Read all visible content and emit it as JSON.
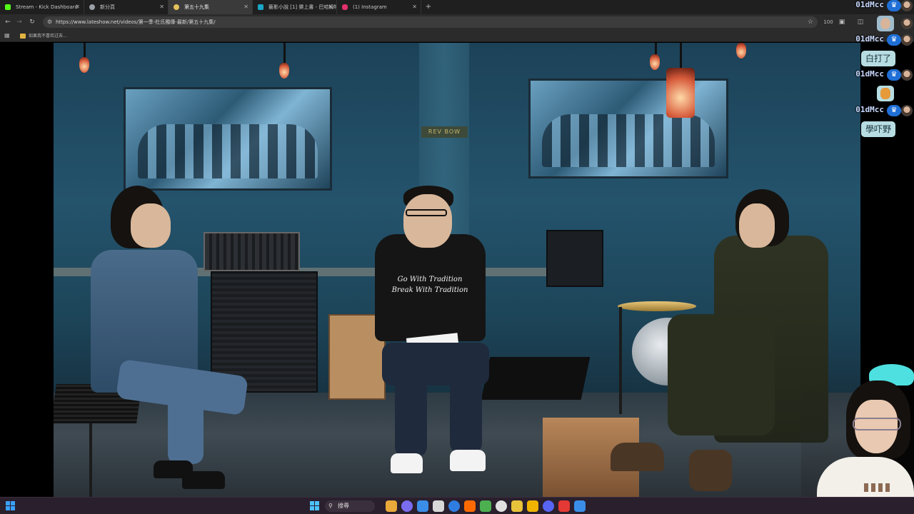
{
  "browser": {
    "tabs": [
      {
        "label": "Stream - Kick Dashboard",
        "favicon_color": "#53fc18",
        "active": false
      },
      {
        "label": "新分頁",
        "favicon_color": "#9aa0a6",
        "active": false
      },
      {
        "label": "第五十九集",
        "favicon_color": "#e2c15a",
        "active": true
      },
      {
        "label": "藝影小說 [1] 樂上書 - 巴哈姆特",
        "favicon_color": "#1aa7c7",
        "active": false
      },
      {
        "label": "(1) Instagram",
        "favicon_color": "#e1306c",
        "active": false
      }
    ],
    "new_tab_label": "+",
    "address": "https://www.lateshow.net/videos/第一季-杜氏獨傳-最新/第五十九集/",
    "zoom_badge": "100",
    "bookmarks": [
      {
        "label": "如果我不喜欢过去…"
      }
    ]
  },
  "chat": {
    "username": "01dMcc",
    "messages": [
      {
        "text": "白打了"
      },
      {
        "text": "學吓野"
      }
    ]
  },
  "video": {
    "shirt_line1": "Go With Tradition",
    "shirt_line2": "Break With Tradition",
    "sign_text": "REV BOW"
  },
  "taskbar": {
    "search_label": "搜尋",
    "icon_colors": [
      "#e8a93a",
      "#7a6cf0",
      "#3a8ee8",
      "#d8d8d8",
      "#2f7de1",
      "#ff6a00",
      "#4caf50",
      "#e0e0e0",
      "#e8c23a",
      "#f0b400",
      "#5865f2",
      "#e53935",
      "#3a8ee8"
    ]
  }
}
